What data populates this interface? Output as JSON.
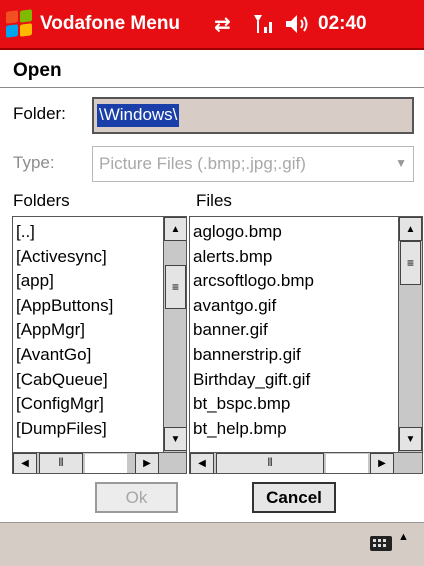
{
  "titlebar": {
    "title": "Vodafone Menu",
    "clock": "02:40",
    "icons": [
      "windows-start-icon",
      "connectivity-icon",
      "signal-icon",
      "volume-icon"
    ],
    "bg_color": "#e60e12"
  },
  "dialog": {
    "heading": "Open",
    "folder_label": "Folder:",
    "folder_value": "\\Windows\\",
    "type_label": "Type:",
    "type_value": "Picture Files (.bmp;.jpg;.gif)",
    "folders_label": "Folders",
    "files_label": "Files",
    "ok_label": "Ok",
    "cancel_label": "Cancel"
  },
  "folders": [
    "[..]",
    "[Activesync]",
    "[app]",
    "[AppButtons]",
    "[AppMgr]",
    "[AvantGo]",
    "[CabQueue]",
    "[ConfigMgr]",
    "[DumpFiles]"
  ],
  "files": [
    "aglogo.bmp",
    "alerts.bmp",
    "arcsoftlogo.bmp",
    "avantgo.gif",
    "banner.gif",
    "bannerstrip.gif",
    "Birthday_gift.gif",
    "bt_bspc.bmp",
    "bt_help.bmp"
  ],
  "colors": {
    "selection": "#1a3fa8",
    "field_bg": "#d8ccc6",
    "taskbar_bg": "#d6ccc6"
  }
}
